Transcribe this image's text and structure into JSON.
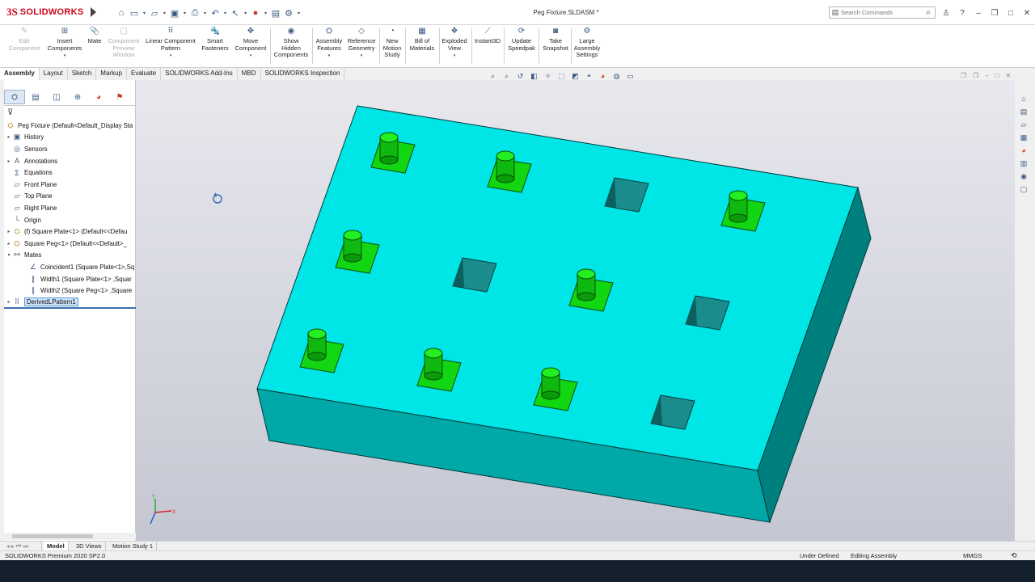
{
  "app": {
    "logo_ds": "3S",
    "logo_text": "SOLIDWORKS",
    "document_title": "Peg Fixture.SLDASM *",
    "search_placeholder": "Search Commands",
    "brand_red": "#d0021b"
  },
  "quick_access": [
    "home-icon",
    "new-icon",
    "open-icon",
    "save-icon",
    "print-icon",
    "undo-icon",
    "select-icon",
    "rebuild-icon",
    "file-properties-icon",
    "options-icon"
  ],
  "ribbon": {
    "buttons": [
      {
        "id": "edit-component",
        "label_lines": [
          "Edit",
          "Component"
        ],
        "disabled": true,
        "icon": "edit-component-icon"
      },
      {
        "id": "insert-components",
        "label_lines": [
          "Insert",
          "Components"
        ],
        "disabled": false,
        "icon": "insert-components-icon"
      },
      {
        "id": "mate",
        "label_lines": [
          "Mate"
        ],
        "disabled": false,
        "icon": "mate-icon"
      },
      {
        "id": "component-preview-window",
        "label_lines": [
          "Component",
          "Preview",
          "Window"
        ],
        "disabled": true,
        "icon": "preview-window-icon"
      },
      {
        "id": "linear-component-pattern",
        "label_lines": [
          "Linear Component",
          "Pattern"
        ],
        "disabled": false,
        "icon": "linear-pattern-icon"
      },
      {
        "id": "smart-fasteners",
        "label_lines": [
          "Smart",
          "Fasteners"
        ],
        "disabled": false,
        "icon": "smart-fasteners-icon"
      },
      {
        "id": "move-component",
        "label_lines": [
          "Move",
          "Component"
        ],
        "disabled": false,
        "icon": "move-component-icon"
      },
      {
        "id": "show-hidden-components",
        "label_lines": [
          "Show",
          "Hidden",
          "Components"
        ],
        "disabled": false,
        "icon": "show-hidden-icon"
      },
      {
        "id": "assembly-features",
        "label_lines": [
          "Assembly",
          "Features"
        ],
        "disabled": false,
        "icon": "assembly-features-icon"
      },
      {
        "id": "reference-geometry",
        "label_lines": [
          "Reference",
          "Geometry"
        ],
        "disabled": false,
        "icon": "reference-geometry-icon"
      },
      {
        "id": "new-motion-study",
        "label_lines": [
          "New",
          "Motion",
          "Study"
        ],
        "disabled": false,
        "icon": "motion-study-icon"
      },
      {
        "id": "bill-of-materials",
        "label_lines": [
          "Bill of",
          "Materials"
        ],
        "disabled": false,
        "icon": "bill-of-materials-icon"
      },
      {
        "id": "exploded-view",
        "label_lines": [
          "Exploded",
          "View"
        ],
        "disabled": false,
        "icon": "exploded-view-icon"
      },
      {
        "id": "instant3d",
        "label_lines": [
          "Instant3D"
        ],
        "disabled": false,
        "icon": "instant3d-icon"
      },
      {
        "id": "update-speedpak",
        "label_lines": [
          "Update",
          "Speedpak"
        ],
        "disabled": false,
        "icon": "speedpak-icon"
      },
      {
        "id": "take-snapshot",
        "label_lines": [
          "Take",
          "Snapshot"
        ],
        "disabled": false,
        "icon": "camera-icon"
      },
      {
        "id": "large-assembly-settings",
        "label_lines": [
          "Large",
          "Assembly",
          "Settings"
        ],
        "disabled": false,
        "icon": "large-assembly-icon"
      }
    ]
  },
  "tabs": [
    "Assembly",
    "Layout",
    "Sketch",
    "Markup",
    "Evaluate",
    "SOLIDWORKS Add-Ins",
    "MBD",
    "SOLIDWORKS Inspection"
  ],
  "active_tab": "Assembly",
  "feature_tree": [
    {
      "label": "Peg Fixture  (Default<Default_Display Sta",
      "icon": "assembly-icon",
      "expander": "",
      "level": 0
    },
    {
      "label": "History",
      "icon": "history-icon",
      "expander": "▸",
      "level": 1
    },
    {
      "label": "Sensors",
      "icon": "sensor-icon",
      "expander": "",
      "level": 1
    },
    {
      "label": "Annotations",
      "icon": "annotation-icon",
      "expander": "▸",
      "level": 1
    },
    {
      "label": "Equations",
      "icon": "equation-icon",
      "expander": "",
      "level": 1
    },
    {
      "label": "Front Plane",
      "icon": "plane-icon",
      "expander": "",
      "level": 1
    },
    {
      "label": "Top Plane",
      "icon": "plane-icon",
      "expander": "",
      "level": 1
    },
    {
      "label": "Right Plane",
      "icon": "plane-icon",
      "expander": "",
      "level": 1
    },
    {
      "label": "Origin",
      "icon": "origin-icon",
      "expander": "",
      "level": 1
    },
    {
      "label": "(f) Square Plate<1> (Default<<Defau",
      "icon": "part-icon",
      "expander": "▸",
      "level": 1
    },
    {
      "label": "Square Peg<1> (Default<<Default>_",
      "icon": "part-icon",
      "expander": "▸",
      "level": 1
    },
    {
      "label": "Mates",
      "icon": "mates-icon",
      "expander": "▾",
      "level": 1
    },
    {
      "label": "Coincident1 (Square Plate<1>,Sq",
      "icon": "coincident-icon",
      "expander": "",
      "level": 2
    },
    {
      "label": "Width1 (Square Plate<1> ,Squar",
      "icon": "width-mate-icon",
      "expander": "",
      "level": 2
    },
    {
      "label": "Width2 (Square Peg<1> ,Square",
      "icon": "width-mate-icon",
      "expander": "",
      "level": 2
    },
    {
      "label": "DerivedLPattern1",
      "icon": "pattern-icon",
      "expander": "▸",
      "level": 1,
      "selected": true
    }
  ],
  "bottom_tabs": [
    "Model",
    "3D Views",
    "Motion Study 1"
  ],
  "status": {
    "left": "SOLIDWORKS Premium 2020 SP2.0",
    "state": "Under Defined",
    "mode": "Editing Assembly",
    "units": "MMGS"
  },
  "colors": {
    "plate_top": "#00e5e6",
    "plate_front": "#00a8a8",
    "plate_side": "#007c7c",
    "peg_green": "#10d010",
    "viewport_top": "#e8e8ee",
    "viewport_bottom": "#c4c7d2"
  }
}
